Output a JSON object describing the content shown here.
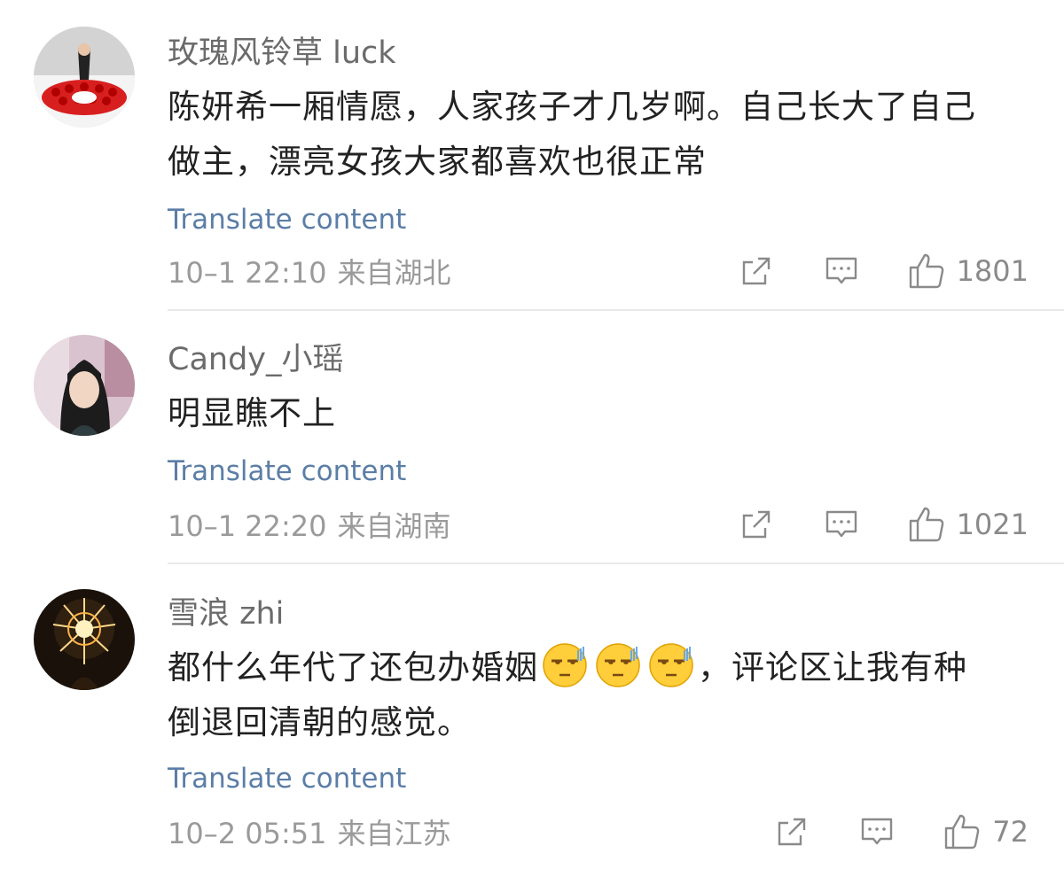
{
  "comments": [
    {
      "username": "玫瑰风铃草 luck",
      "text_line1": "陈妍希一厢情愿，人家孩子才几岁啊。自己长大了自己",
      "text_line2": "做主，漂亮女孩大家都喜欢也很正常",
      "translate_label": "Translate content",
      "time": "10–1 22:10",
      "location": "来自湖北",
      "likes": "1801",
      "avatar_icon": "user-photo-roses"
    },
    {
      "username": "Candy_小瑶",
      "text_line1": "明显瞧不上",
      "translate_label": "Translate content",
      "time": "10–1 22:20",
      "location": "来自湖南",
      "likes": "1021",
      "avatar_icon": "user-photo-girl"
    },
    {
      "username": "雪浪 zhi",
      "text_line1_a": "都什么年代了还包办婚姻",
      "text_line1_b": "，评论区让我有种",
      "text_line2": "倒退回清朝的感觉。",
      "translate_label": "Translate content",
      "time": "10–2 05:51",
      "location": "来自江苏",
      "likes": "72",
      "avatar_icon": "user-photo-sparkler",
      "emoji_icon": "sweat-speechless-emoji"
    }
  ],
  "colors": {
    "link": "#5b7ea6",
    "meta": "#9a9a9a",
    "username": "#6b6b6b",
    "divider": "#e9e9e9"
  },
  "icons": [
    "share-icon",
    "comment-icon",
    "like-icon"
  ]
}
